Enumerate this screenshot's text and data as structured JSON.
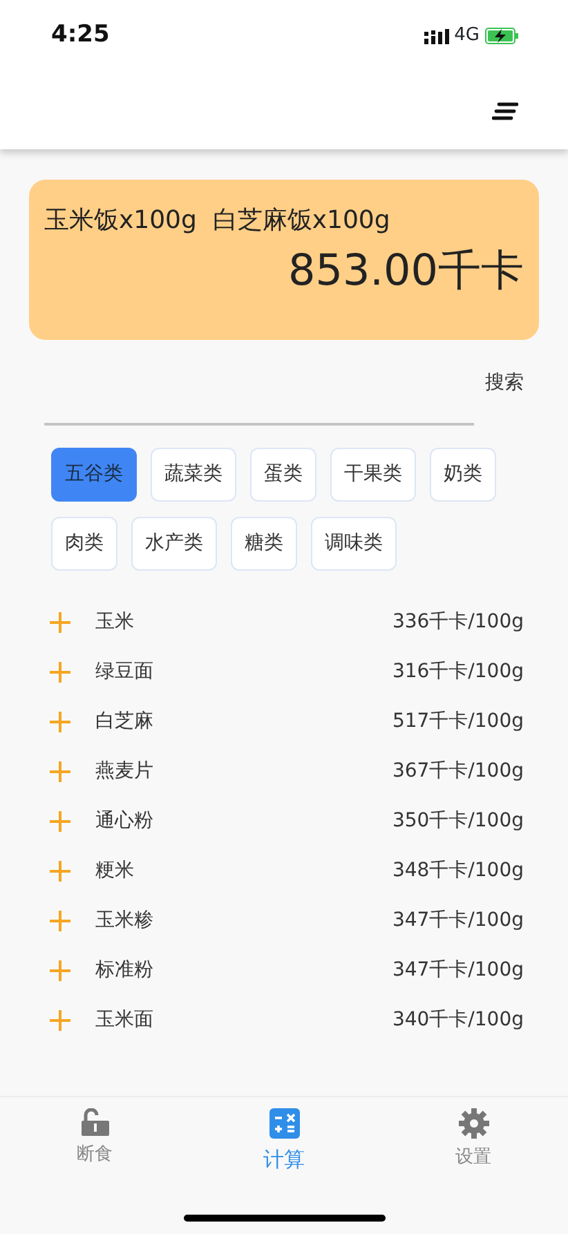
{
  "status_bar": {
    "time": "4:25",
    "network": "4G"
  },
  "summary": {
    "foods": "玉米饭x100g  白芝麻饭x100g",
    "total": "853.00千卡"
  },
  "search": {
    "button": "搜索"
  },
  "categories": [
    {
      "label": "五谷类",
      "selected": true
    },
    {
      "label": "蔬菜类",
      "selected": false
    },
    {
      "label": "蛋类",
      "selected": false
    },
    {
      "label": "干果类",
      "selected": false
    },
    {
      "label": "奶类",
      "selected": false
    },
    {
      "label": "肉类",
      "selected": false
    },
    {
      "label": "水产类",
      "selected": false
    },
    {
      "label": "糖类",
      "selected": false
    },
    {
      "label": "调味类",
      "selected": false
    }
  ],
  "foods": [
    {
      "name": "玉米",
      "calories": "336千卡/100g"
    },
    {
      "name": "绿豆面",
      "calories": "316千卡/100g"
    },
    {
      "name": "白芝麻",
      "calories": "517千卡/100g"
    },
    {
      "name": "燕麦片",
      "calories": "367千卡/100g"
    },
    {
      "name": "通心粉",
      "calories": "350千卡/100g"
    },
    {
      "name": "粳米",
      "calories": "348千卡/100g"
    },
    {
      "name": "玉米糁",
      "calories": "347千卡/100g"
    },
    {
      "name": "标准粉",
      "calories": "347千卡/100g"
    },
    {
      "name": "玉米面",
      "calories": "340千卡/100g"
    }
  ],
  "tab_bar": [
    {
      "label": "断食",
      "kind": "fasting",
      "selected": false
    },
    {
      "label": "计算",
      "kind": "calculator",
      "selected": true
    },
    {
      "label": "设置",
      "kind": "settings",
      "selected": false
    }
  ]
}
